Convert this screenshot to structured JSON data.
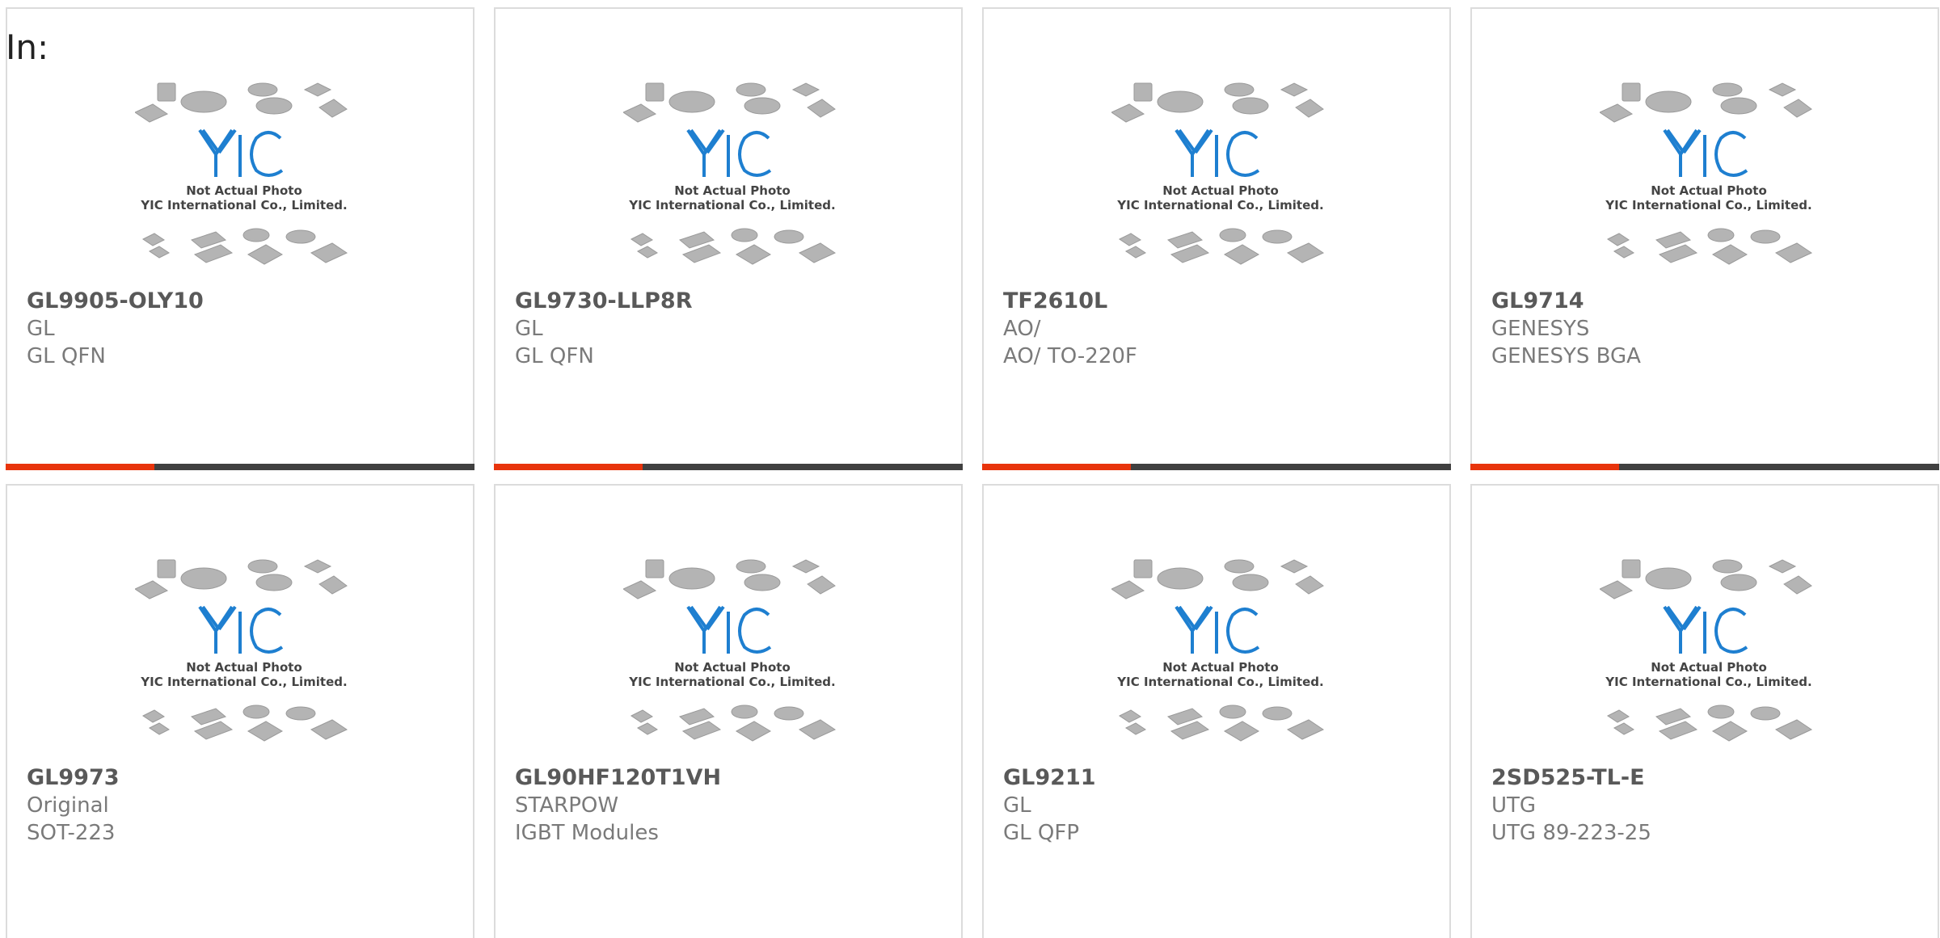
{
  "header": {
    "in_label": "In:"
  },
  "placeholder": {
    "caption_line1": "Not Actual Photo",
    "caption_line2": "YIC International Co., Limited.",
    "brand": "YIC"
  },
  "colors": {
    "accent_red": "#e8340c",
    "bar_dark": "#404040",
    "logo_blue": "#1e7fd0"
  },
  "products": [
    {
      "part_number": "GL9905-OLY10",
      "manufacturer": "GL",
      "package": "GL QFN"
    },
    {
      "part_number": "GL9730-LLP8R",
      "manufacturer": "GL",
      "package": "GL QFN"
    },
    {
      "part_number": "TF2610L",
      "manufacturer": "AO/",
      "package": "AO/ TO-220F"
    },
    {
      "part_number": "GL9714",
      "manufacturer": "GENESYS",
      "package": "GENESYS BGA"
    },
    {
      "part_number": "GL9973",
      "manufacturer": "Original",
      "package": "SOT-223"
    },
    {
      "part_number": "GL90HF120T1VH",
      "manufacturer": "STARPOW",
      "package": "IGBT Modules"
    },
    {
      "part_number": "GL9211",
      "manufacturer": "GL",
      "package": "GL QFP"
    },
    {
      "part_number": "2SD525-TL-E",
      "manufacturer": "UTG",
      "package": "UTG 89-223-25"
    }
  ]
}
